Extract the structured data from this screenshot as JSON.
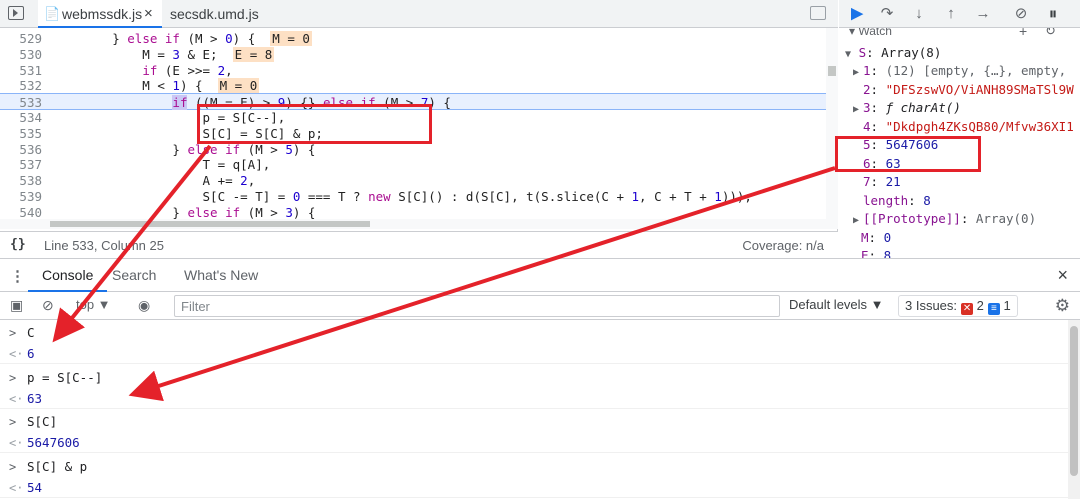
{
  "editor": {
    "tabs": [
      {
        "label": "webmssdk.js",
        "close": "×"
      },
      {
        "label": "secsdk.umd.js"
      }
    ],
    "status": {
      "brace": "{}",
      "position": "Line 533, Column 25",
      "coverage": "Coverage: n/a"
    }
  },
  "code_lines": [
    {
      "n": "529",
      "html": "        } <span class='kw'>else if</span> (M &gt; <span class='num'>0</span>) {  <span class='hl'>M = 0</span>"
    },
    {
      "n": "530",
      "html": "            M = <span class='num'>3</span> &amp; E;  <span class='hl'>E = 8</span>"
    },
    {
      "n": "531",
      "html": "            <span class='kw'>if</span> (E &gt;&gt;= <span class='num'>2</span>,"
    },
    {
      "n": "532",
      "html": "            M &lt; <span class='num'>1</span>) {  <span class='hl'>M = 0</span>"
    },
    {
      "n": "533",
      "html": "                <span class='kw bp'>if</span> ((M = E) &gt; <span class='num'>9</span>) {} <span class='kw'>else if</span> (M &gt; <span class='num'>7</span>) {"
    },
    {
      "n": "534",
      "html": "                    p = S[C--],"
    },
    {
      "n": "535",
      "html": "                    S[C] = S[C] &amp; p;"
    },
    {
      "n": "536",
      "html": "                } <span class='kw'>else if</span> (M &gt; <span class='num'>5</span>) {"
    },
    {
      "n": "537",
      "html": "                    T = q[A],"
    },
    {
      "n": "538",
      "html": "                    A += <span class='num'>2</span>,"
    },
    {
      "n": "539",
      "html": "                    S[C -= T] = <span class='num'>0</span> === T ? <span class='kw'>new</span> S[C]() : d(S[C], t(S.slice(C + <span class='num'>1</span>, C + T + <span class='num'>1</span>)));"
    },
    {
      "n": "540",
      "html": "                } <span class='kw'>else if</span> (M &gt; <span class='num'>3</span>) {"
    }
  ],
  "watch_header": "▾ Watch",
  "scope": {
    "root": {
      "arrow": "▼",
      "name": "S",
      "value": "Array(8)"
    },
    "items": [
      {
        "arrow": "▶",
        "key": "1",
        "value": "(12) [empty, {…}, empty,",
        "kind": "gray"
      },
      {
        "arrow": "",
        "key": "2",
        "value": "\"DFSzswVO/ViANH89SMaTSl9W",
        "kind": "str"
      },
      {
        "arrow": "▶",
        "key": "3",
        "value": "ƒ charAt()",
        "kind": "fn"
      },
      {
        "arrow": "",
        "key": "4",
        "value": "\"Dkdpgh4ZKsQB80/Mfvw36XI1",
        "kind": "str"
      },
      {
        "arrow": "",
        "key": "5",
        "value": "5647606",
        "kind": "numv"
      },
      {
        "arrow": "",
        "key": "6",
        "value": "63",
        "kind": "numv"
      },
      {
        "arrow": "",
        "key": "7",
        "value": "21",
        "kind": "numv"
      },
      {
        "arrow": "",
        "key": "length",
        "value": "8",
        "kind": "numv"
      },
      {
        "arrow": "▶",
        "key": "[[Prototype]]",
        "value": "Array(0)",
        "kind": "gray"
      },
      {
        "arrow": "",
        "key": "M",
        "value": "0",
        "kind": "numv"
      },
      {
        "arrow": "",
        "key": "E",
        "value": "8",
        "kind": "numv"
      }
    ]
  },
  "drawer": {
    "tabs": [
      "Console",
      "Search",
      "What's New"
    ],
    "close": "×"
  },
  "console_toolbar": {
    "context": "top ▼",
    "filter_placeholder": "Filter",
    "levels": "Default levels ▼",
    "issues_label": "3 Issues:",
    "issues_errors": "2",
    "issues_info": "1"
  },
  "console_entries": [
    {
      "input": "C",
      "result": "6"
    },
    {
      "input": "p = S[C--]",
      "result": "63"
    },
    {
      "input": "S[C]",
      "result": "5647606"
    },
    {
      "input": "S[C] & p",
      "result": "54"
    }
  ]
}
